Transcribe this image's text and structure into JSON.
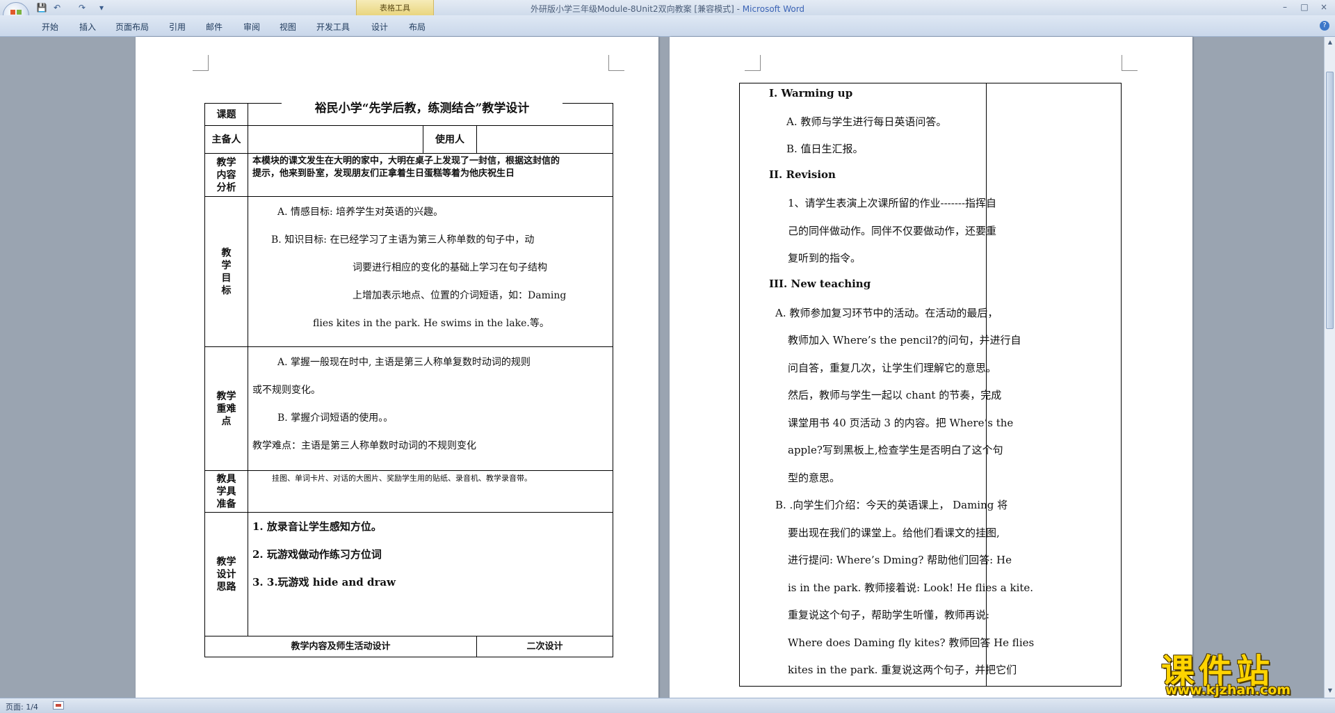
{
  "window": {
    "title": "外研版小学三年级Module-8Unit2双向教案 [兼容模式]",
    "app": "Microsoft Word",
    "context_tab": "表格工具",
    "controls": {
      "minimize": "–",
      "maximize": "□",
      "close": "×"
    }
  },
  "quick_access": {
    "save": "💾",
    "undo": "↶",
    "redo": "↷",
    "more": "▾"
  },
  "ribbon": {
    "tabs": [
      "开始",
      "插入",
      "页面布局",
      "引用",
      "邮件",
      "审阅",
      "视图",
      "开发工具",
      "设计",
      "布局"
    ],
    "help": "?"
  },
  "page1": {
    "title": "裕民小学“先学后教，练测结合”教学设计",
    "rows": {
      "topic_label": "课题",
      "preparer_label": "主备人",
      "user_label": "使用人",
      "content_label": [
        "教学",
        "内容",
        "分析"
      ],
      "content_text": [
        "本模块的课文发生在大明的家中，大明在桌子上发现了一封信，根据这封信的",
        "提示，他来到卧室，发现朋友们正拿着生日蛋糕等着为他庆祝生日"
      ],
      "goals_label": [
        "教",
        "学",
        "目",
        "标"
      ],
      "goals_text": [
        "A. 情感目标: 培养学生对英语的兴趣。",
        "B. 知识目标: 在已经学习了主语为第三人称单数的句子中，动",
        "词要进行相应的变化的基础上学习在句子结构",
        "上增加表示地点、位置的介词短语，如：Daming",
        "flies kites in the park. He swims in the lake.等。"
      ],
      "focus_label": [
        "教学",
        "重难",
        "点"
      ],
      "focus_text": [
        "A. 掌握一般现在时中, 主语是第三人称单复数时动词的规则",
        "或不规则变化。",
        "B. 掌握介词短语的使用。。",
        "教学难点：主语是第三人称单数时动词的不规则变化"
      ],
      "tools_label": [
        "教具",
        "学具",
        "准备"
      ],
      "tools_text": "挂图、单词卡片、对话的大图片、奖励学生用的贴纸、录音机、教学录音带。",
      "design_label": [
        "教学",
        "设计",
        "思路"
      ],
      "design_text": [
        "1.  放录音让学生感知方位。",
        "2.  玩游戏做动作练习方位词",
        "3.  3.玩游戏 hide and draw"
      ],
      "footer_left": "教学内容及师生活动设计",
      "footer_right": "二次设计"
    }
  },
  "page2": {
    "lines": [
      "I. Warming up",
      "A. 教师与学生进行每日英语问答。",
      "B. 值日生汇报。",
      "II. Revision",
      "1、请学生表演上次课所留的作业-------指挥自",
      "己的同伴做动作。同伴不仅要做动作，还要重",
      "复听到的指令。",
      "III. New teaching",
      "A. 教师参加复习环节中的活动。在活动的最后，",
      "教师加入 Where’s the pencil?的问句，并进行自",
      "问自答，重复几次，让学生们理解它的意思。",
      "然后，教师与学生一起以 chant 的节奏，完成",
      "课堂用书 40 页活动 3 的内容。把 Where’s the",
      "apple?写到黑板上,检查学生是否明白了这个句",
      "型的意思。",
      "B. .向学生们介绍：今天的英语课上， Daming 将",
      "要出现在我们的课堂上。给他们看课文的挂图,",
      "进行提问: Where’s Dming? 帮助他们回答: He",
      "is in the park. 教师接着说: Look! He flies a kite.",
      "重复说这个句子，帮助学生听懂，教师再说:",
      "Where does Daming fly kites? 教师回答 He flies",
      "kites in the park. 重复说这两个句子，并把它们"
    ]
  },
  "status": {
    "page": "页面: 1/4"
  },
  "watermark": {
    "title": "课件站",
    "url": "www.kjzhan.com"
  }
}
